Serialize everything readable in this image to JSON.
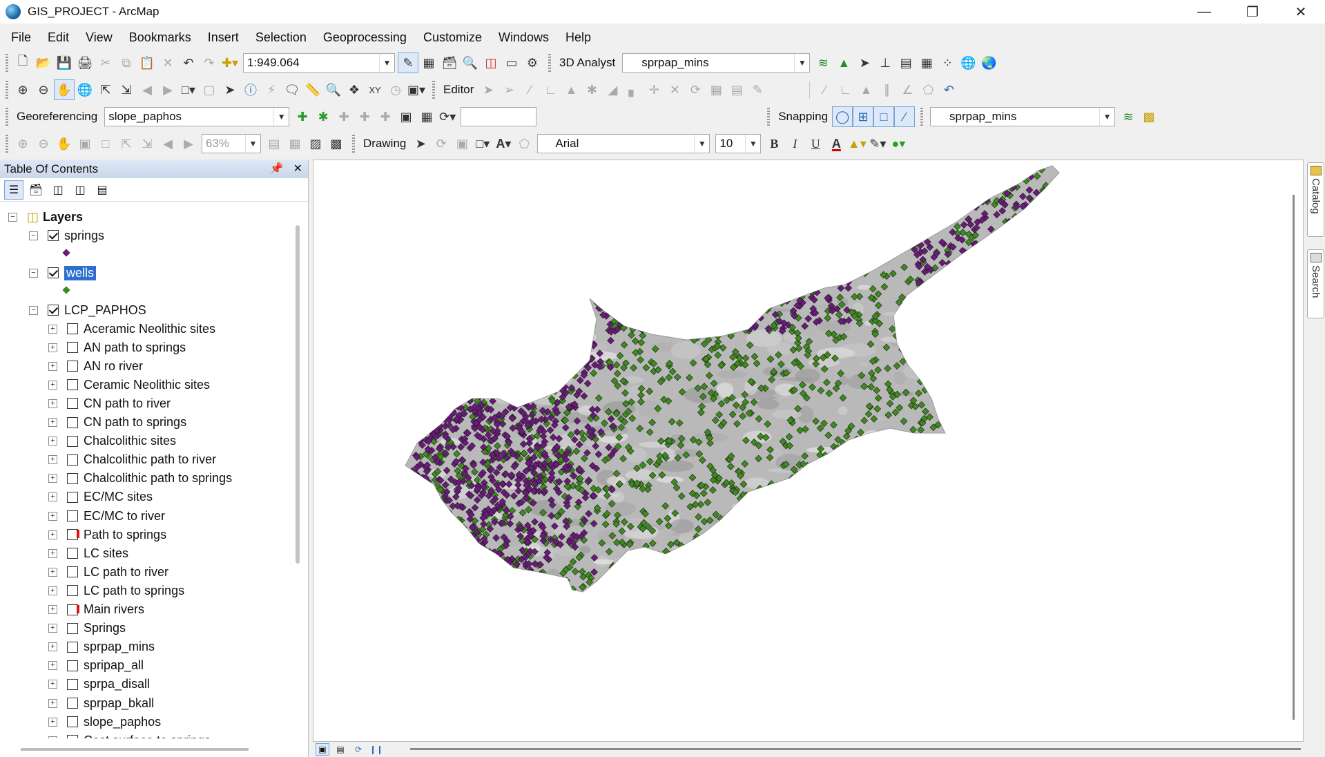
{
  "window": {
    "title": "GIS_PROJECT - ArcMap"
  },
  "menu": [
    "File",
    "Edit",
    "View",
    "Bookmarks",
    "Insert",
    "Selection",
    "Geoprocessing",
    "Customize",
    "Windows",
    "Help"
  ],
  "toolbar": {
    "scale_value": "1:949.064",
    "analyst_label": "3D Analyst",
    "analyst_layer": "sprpap_mins",
    "editor_label": "Editor",
    "georef_label": "Georeferencing",
    "georef_layer": "slope_paphos",
    "snapping_label": "Snapping",
    "snapping_layer": "sprpap_mins",
    "zoom_value": "63%",
    "drawing_label": "Drawing",
    "font_name": "Arial",
    "font_size": "10",
    "bold_label": "B",
    "italic_label": "I",
    "underline_label": "U",
    "font_color_label": "A"
  },
  "toc": {
    "title": "Table Of Contents",
    "root": "Layers",
    "springs_layer": "springs",
    "wells_layer": "wells",
    "group": "LCP_PAPHOS",
    "springs_color": "#6a1b7a",
    "wells_color": "#3e8a1e",
    "sublayers": [
      {
        "label": "Aceramic Neolithic sites",
        "state": "off"
      },
      {
        "label": "AN path to springs",
        "state": "off"
      },
      {
        "label": "AN ro river",
        "state": "off"
      },
      {
        "label": "Ceramic Neolithic sites",
        "state": "off"
      },
      {
        "label": "CN path to river",
        "state": "off"
      },
      {
        "label": "CN path to springs",
        "state": "off"
      },
      {
        "label": "Chalcolithic sites",
        "state": "off"
      },
      {
        "label": "Chalcolithic path to river",
        "state": "off"
      },
      {
        "label": "Chalcolithic path to springs",
        "state": "off"
      },
      {
        "label": "EC/MC sites",
        "state": "off"
      },
      {
        "label": "EC/MC to river",
        "state": "off"
      },
      {
        "label": "Path to springs",
        "state": "broken"
      },
      {
        "label": "LC sites",
        "state": "off"
      },
      {
        "label": "LC path to river",
        "state": "off"
      },
      {
        "label": "LC path to springs",
        "state": "off"
      },
      {
        "label": "Main rivers",
        "state": "broken"
      },
      {
        "label": "Springs",
        "state": "off"
      },
      {
        "label": "sprpap_mins",
        "state": "off"
      },
      {
        "label": "spripap_all",
        "state": "off"
      },
      {
        "label": "sprpa_disall",
        "state": "off"
      },
      {
        "label": "sprpap_bkall",
        "state": "off"
      },
      {
        "label": "slope_paphos",
        "state": "off"
      },
      {
        "label": "Cost surface to springs",
        "state": "off"
      }
    ]
  },
  "side_tabs": {
    "catalog": "Catalog",
    "search": "Search"
  },
  "map": {
    "island_color": "#b9b9b9",
    "wells_color": "#3e8a1e",
    "springs_color": "#6a1b7a"
  }
}
